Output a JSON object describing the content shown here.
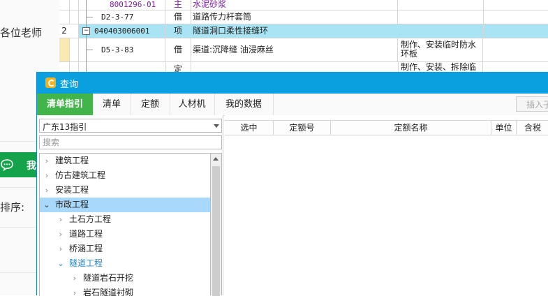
{
  "background": {
    "teacher_text": "各位老师",
    "green_button_text": "我",
    "sort_label": "排序:",
    "sheet": {
      "rows": [
        {
          "seq": "",
          "code": "8001296-01",
          "type": "主",
          "name": "水泥砂浆",
          "desc": ""
        },
        {
          "seq": "",
          "code": "D2-3-77",
          "type": "借",
          "name": "道路传力杆套筒",
          "desc": ""
        },
        {
          "seq": "2",
          "code": "040403006001",
          "type": "项",
          "name": "隧道洞口柔性接缝环",
          "desc": ""
        },
        {
          "seq": "",
          "code": "D5-3-83",
          "type": "借",
          "name": "渠道:沉降缝 油浸麻丝",
          "desc": "制作、安装临时防水环板"
        },
        {
          "seq": "",
          "code": "",
          "type": "定",
          "name": "",
          "desc": "制作、安装、拆除临"
        }
      ]
    }
  },
  "dialog": {
    "title": "查询",
    "tabs": [
      {
        "label": "清单指引",
        "active": true
      },
      {
        "label": "清单",
        "active": false
      },
      {
        "label": "定额",
        "active": false
      },
      {
        "label": "人材机",
        "active": false
      },
      {
        "label": "我的数据",
        "active": false
      }
    ],
    "insert_button": "插入子",
    "left_panel": {
      "combo_value": "广东13指引",
      "search_placeholder": "搜索",
      "tree": [
        {
          "label": "建筑工程",
          "level": 0,
          "expanded": false,
          "selected": false
        },
        {
          "label": "仿古建筑工程",
          "level": 0,
          "expanded": false,
          "selected": false
        },
        {
          "label": "安装工程",
          "level": 0,
          "expanded": false,
          "selected": false
        },
        {
          "label": "市政工程",
          "level": 0,
          "expanded": true,
          "selected": true
        },
        {
          "label": "土石方工程",
          "level": 1,
          "expanded": false,
          "selected": false
        },
        {
          "label": "道路工程",
          "level": 1,
          "expanded": false,
          "selected": false
        },
        {
          "label": "桥涵工程",
          "level": 1,
          "expanded": false,
          "selected": false
        },
        {
          "label": "隧道工程",
          "level": 1,
          "expanded": true,
          "selected": false
        },
        {
          "label": "隧道岩石开挖",
          "level": 2,
          "expanded": false,
          "selected": false
        },
        {
          "label": "岩石隧道衬砌",
          "level": 2,
          "expanded": false,
          "selected": false
        }
      ]
    },
    "grid": {
      "columns": [
        "选中",
        "定额号",
        "定额名称",
        "单位",
        "含税"
      ]
    }
  },
  "colors": {
    "title_bar": "#0aa0e0",
    "active_tab": "#42b54a",
    "selected_row": "#a8e4f4",
    "tree_selected": "#a8d8fb"
  }
}
